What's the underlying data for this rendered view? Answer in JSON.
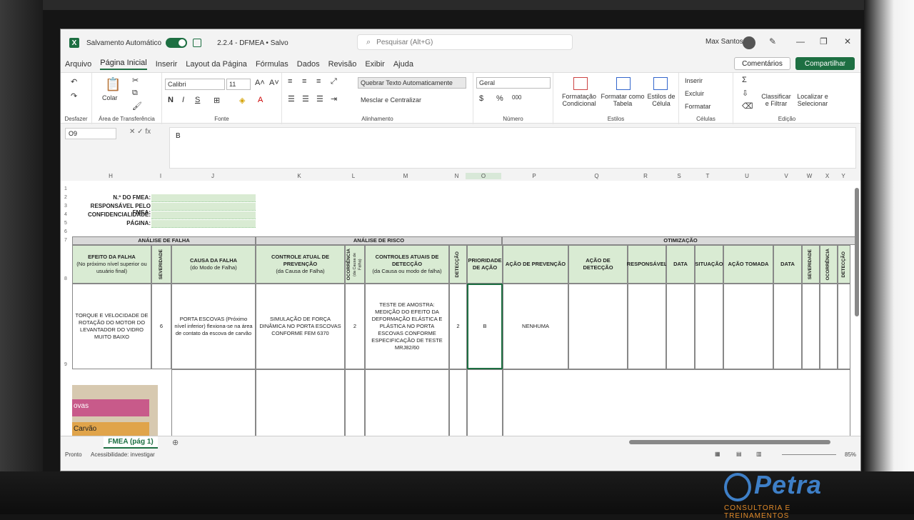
{
  "titlebar": {
    "autosave": "Salvamento Automático",
    "doc": "2.2.4 - DFMEA • Salvo",
    "search": "Pesquisar (Alt+G)",
    "user": "Max Santos"
  },
  "menu": [
    "Arquivo",
    "Página Inicial",
    "Inserir",
    "Layout da Página",
    "Fórmulas",
    "Dados",
    "Revisão",
    "Exibir",
    "Ajuda"
  ],
  "buttons": {
    "comments": "Comentários",
    "share": "Compartilhar"
  },
  "ribbon": {
    "undo_group": "Desfazer",
    "clipboard": "Área de Transferência",
    "paste": "Colar",
    "font_group": "Fonte",
    "font": "Calibri",
    "size": "11",
    "align_group": "Alinhamento",
    "wrap": "Quebrar Texto Automaticamente",
    "merge": "Mesclar e Centralizar",
    "number_group": "Número",
    "number_format": "Geral",
    "styles_group": "Estilos",
    "cond": "Formatação Condicional",
    "as_table": "Formatar como Tabela",
    "cell_styles": "Estilos de Célula",
    "cells_group": "Células",
    "insert": "Inserir",
    "delete": "Excluir",
    "format": "Formatar",
    "edit_group": "Edição",
    "sort": "Classificar e Filtrar",
    "find": "Localizar e Selecionar"
  },
  "formula": {
    "cell": "O9",
    "value": "B"
  },
  "columns": [
    "H",
    "I",
    "J",
    "K",
    "L",
    "M",
    "N",
    "O",
    "P",
    "Q",
    "R",
    "S",
    "T",
    "U",
    "V",
    "W",
    "X",
    "Y"
  ],
  "sheet": {
    "labels": [
      "N.º DO FMEA:",
      "RESPONSÁVEL PELO FMEA:",
      "CONFIDENCIALIDADE:",
      "PÁGINA:"
    ],
    "sections": {
      "falha": "ANÁLISE DE FALHA",
      "risco": "ANÁLISE DE RISCO",
      "otim": "OTIMIZAÇÃO"
    },
    "headers": {
      "efeito": "EFEITO DA FALHA",
      "efeito_sub": "(No próximo nível superior ou usuário final)",
      "sev": "SEVERIDADE",
      "causa": "CAUSA DA FALHA",
      "causa_sub": "(do Modo de Falha)",
      "prev": "CONTROLE ATUAL DE PREVENÇÃO",
      "prev_sub": "(da Causa de Falha)",
      "ocor": "OCORRÊNCIA",
      "ocor_sub": "(da Causa de Falha)",
      "det_ctrl": "CONTROLES ATUAIS DE DETECÇÃO",
      "det_sub": "(da Causa ou modo de falha)",
      "det": "DETECÇÃO",
      "prio": "PRIORIDADE DE AÇÃO",
      "acao_prev": "AÇÃO DE PREVENÇÃO",
      "acao_det": "AÇÃO DE DETECÇÃO",
      "resp": "RESPONSÁVEL",
      "data": "DATA",
      "sit": "SITUAÇÃO",
      "tomada": "AÇÃO TOMADA",
      "data2": "DATA",
      "sev2": "SEVERIDADE",
      "ocor2": "OCORRÊNCIA",
      "det2": "DETECÇÃO"
    },
    "row9": {
      "efeito": "TORQUE E VELOCIDADE DE ROTAÇÃO DO MOTOR DO LEVANTADOR DO VIDRO MUITO BAIXO",
      "sev": "6",
      "causa": "PORTA ESCOVAS (Próximo nível inferior) flexiona-se na área de contato da escova de carvão",
      "prev": "SIMULAÇÃO DE FORÇA DINÂMICA NO PORTA ESCOVAS CONFORME FEM 6370",
      "ocor": "2",
      "det_ctrl": "TESTE DE AMOSTRA: MEDIÇÃO DO EFEITO DA DEFORMAÇÃO ELÁSTICA E PLÁSTICA NO PORTA ESCOVAS CONFORME ESPECIFICAÇÃO DE TESTE MRJ82/60",
      "det": "2",
      "prio": "B",
      "acao_prev": "NENHUMA"
    },
    "photo": {
      "a": "ovas",
      "b": "Carvão"
    }
  },
  "tab": "FMEA (pág 1)",
  "status": {
    "ready": "Pronto",
    "access": "Acessibilidade: investigar",
    "zoom": "85%"
  },
  "logo": {
    "name": "Petra",
    "sub": "CONSULTORIA E TREINAMENTOS"
  }
}
